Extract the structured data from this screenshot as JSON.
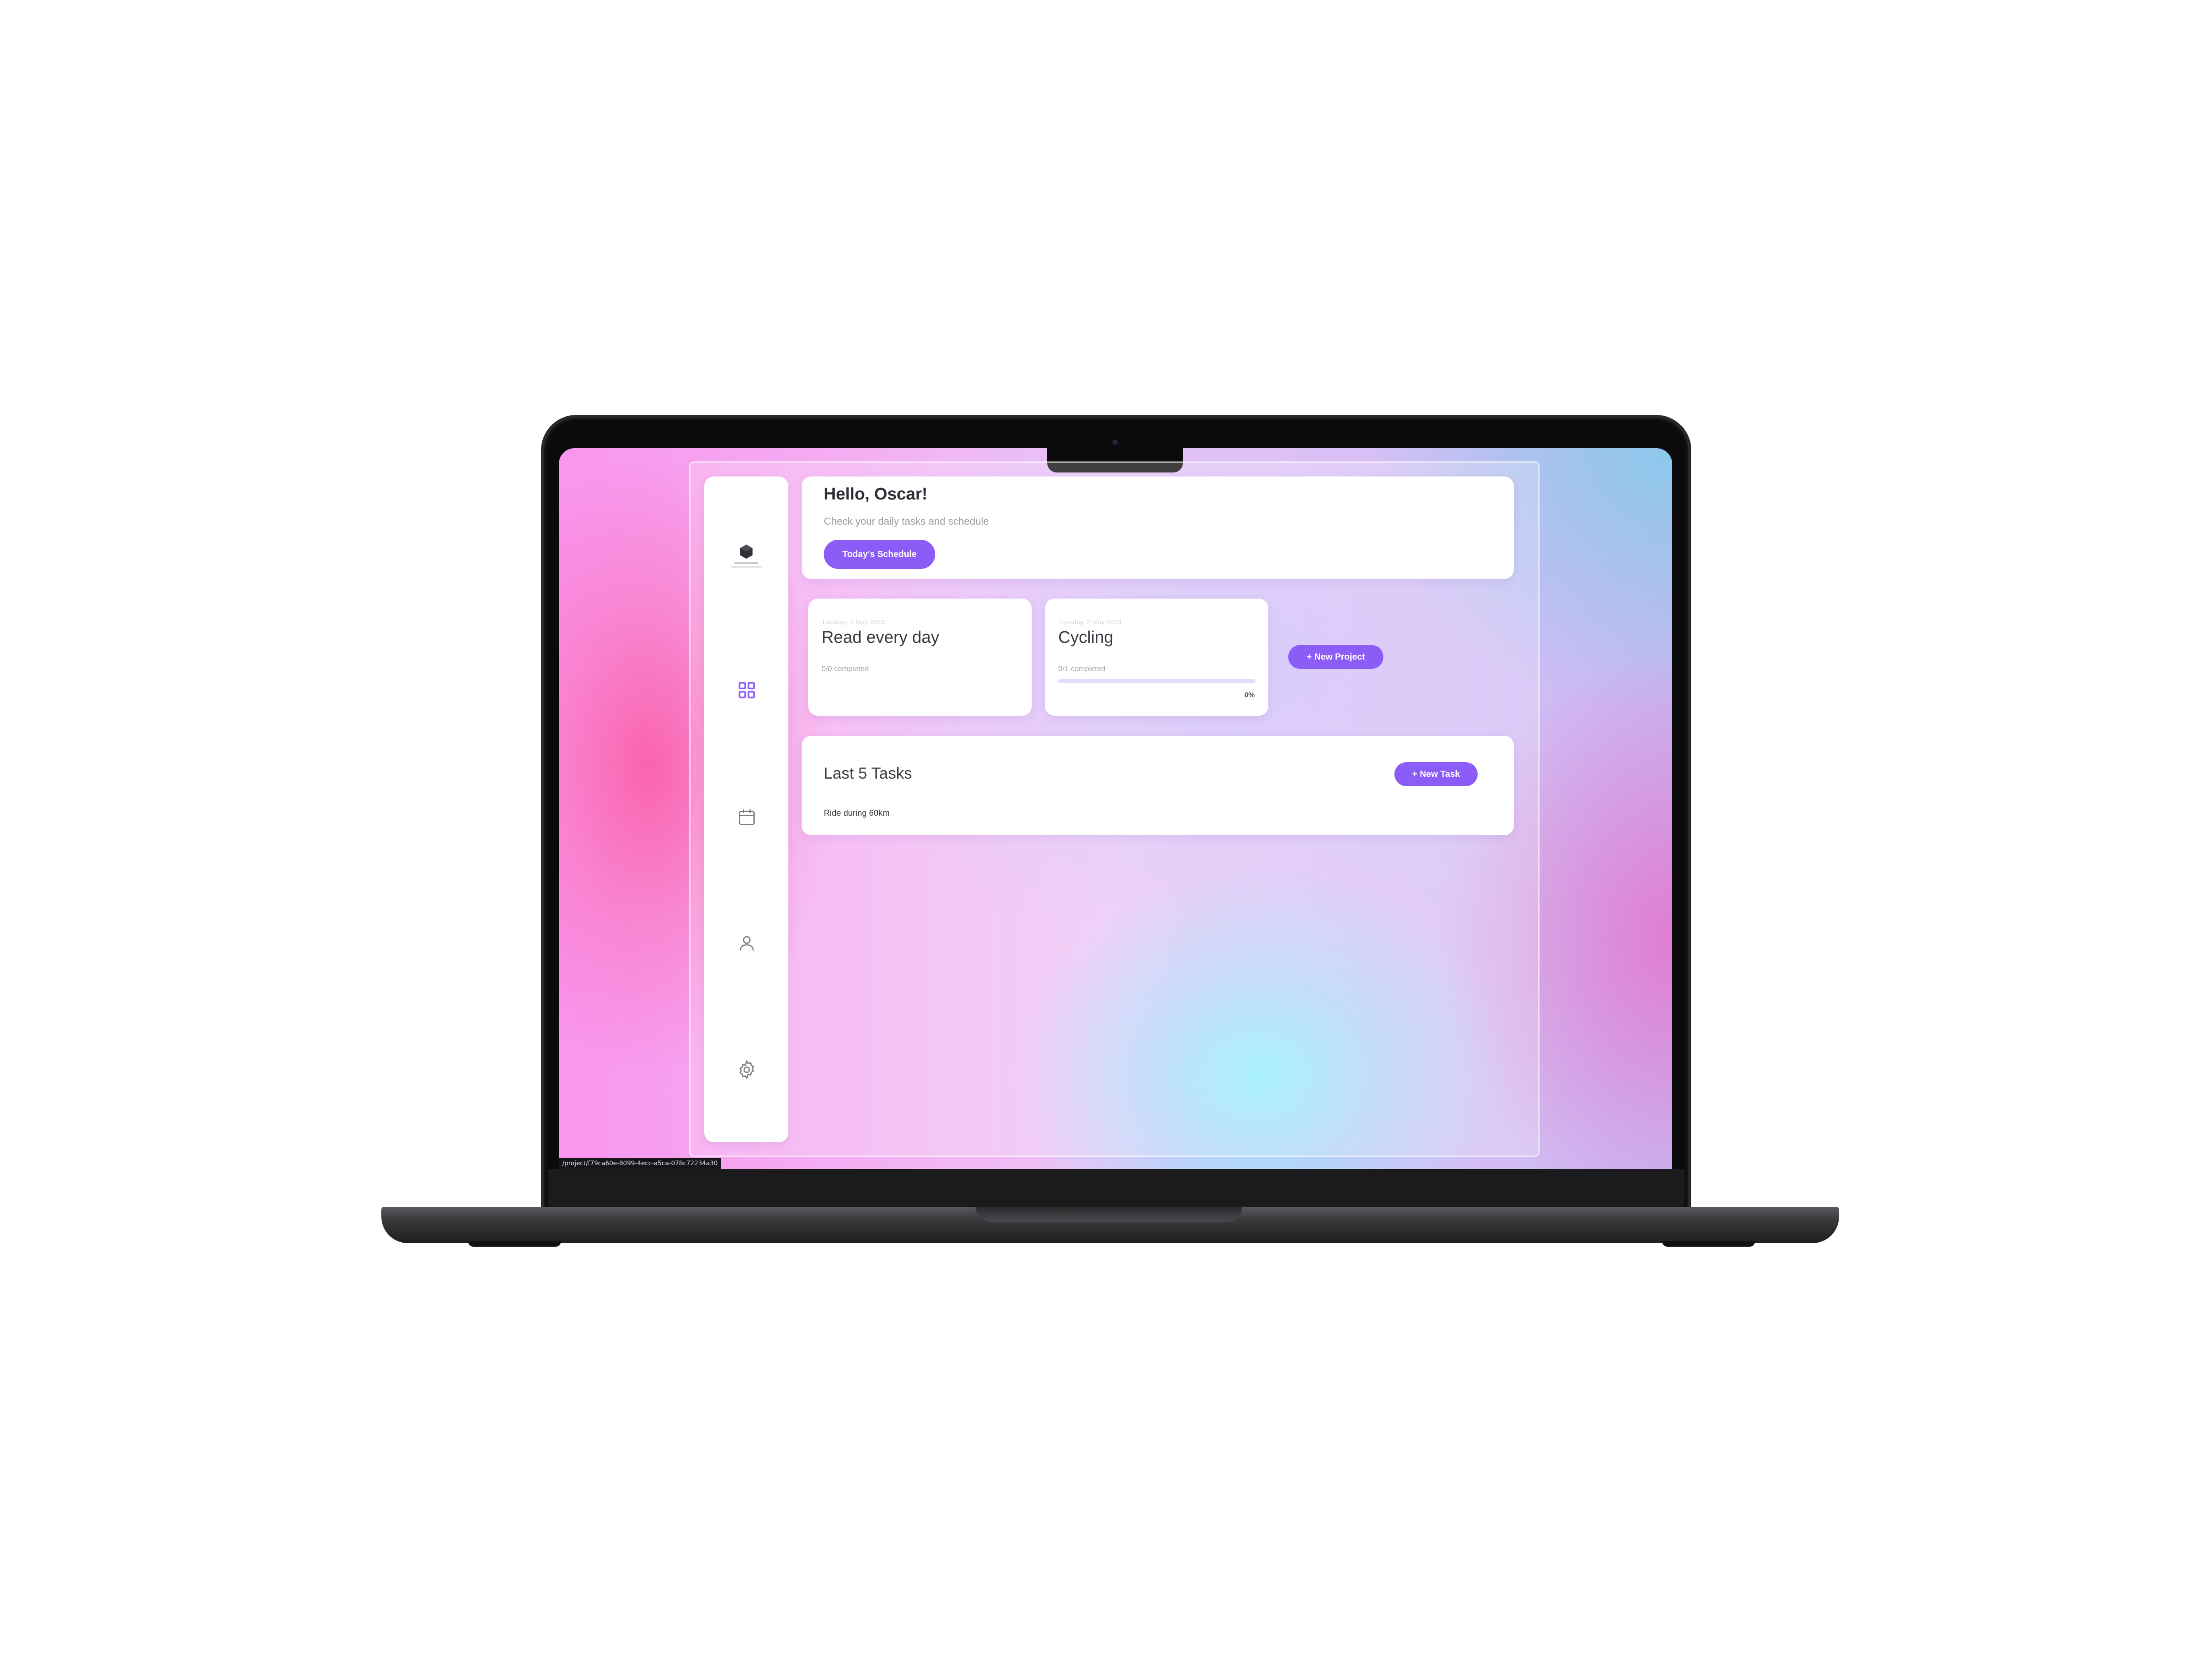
{
  "colors": {
    "accent": "#8b5cf6",
    "accent_light": "#e4dcfb",
    "card_bg": "#ffffff",
    "text_dark": "#2e2e36",
    "text_muted": "#9a9aa2"
  },
  "sidebar": {
    "logo_icon": "hexagon-logo-icon",
    "items": [
      {
        "name": "dashboard",
        "icon": "grid-icon",
        "active": true
      },
      {
        "name": "calendar",
        "icon": "calendar-icon",
        "active": false
      },
      {
        "name": "profile",
        "icon": "user-icon",
        "active": false
      },
      {
        "name": "settings",
        "icon": "gear-icon",
        "active": false
      }
    ]
  },
  "greeting": {
    "title": "Hello, Oscar!",
    "subtitle": "Check your daily tasks and schedule",
    "button_label": "Today's Schedule"
  },
  "projects": [
    {
      "date": "Tuesday, 2 May 2023",
      "title": "Read every day",
      "completed": "0/0 completed",
      "show_progress": false
    },
    {
      "date": "Tuesday, 2 May 2023",
      "title": "Cycling",
      "completed": "0/1 completed",
      "show_progress": true,
      "progress": 0,
      "progress_label": "0%"
    }
  ],
  "new_project_label": "+ New Project",
  "tasks": {
    "title": "Last 5 Tasks",
    "new_task_label": "+ New Task",
    "items": [
      "Ride during 60km"
    ]
  },
  "status_url": "/project/f79ca60e-8099-4ecc-a5ca-078c72234a30"
}
